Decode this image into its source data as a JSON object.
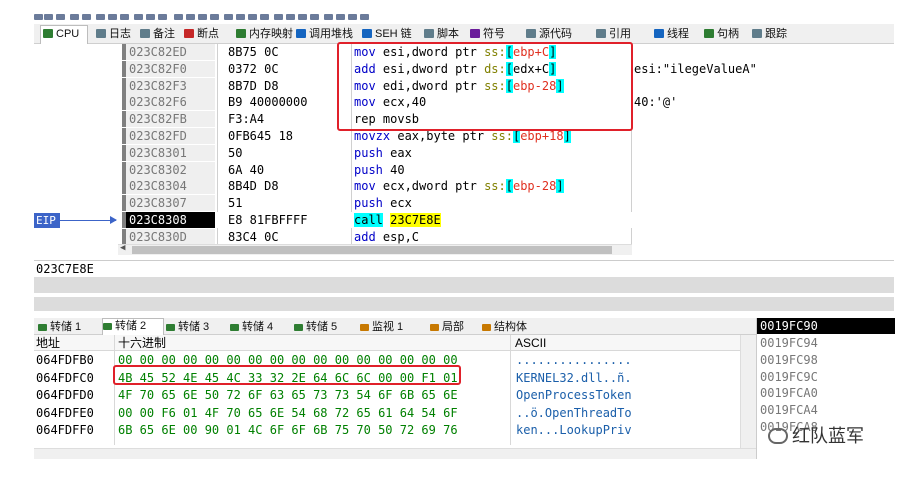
{
  "tabs": [
    {
      "label": "CPU",
      "icon": "cpu-icon",
      "color": "#2e7d32",
      "active": true
    },
    {
      "label": "日志",
      "icon": "log-icon",
      "color": "#607d8b"
    },
    {
      "label": "备注",
      "icon": "notes-icon",
      "color": "#607d8b"
    },
    {
      "label": "断点",
      "icon": "breakpoint-icon",
      "color": "#c62828"
    },
    {
      "label": "内存映射",
      "icon": "memory-map-icon",
      "color": "#2e7d32"
    },
    {
      "label": "调用堆栈",
      "icon": "call-stack-icon",
      "color": "#1565c0"
    },
    {
      "label": "SEH 链",
      "icon": "seh-chain-icon",
      "color": "#1565c0"
    },
    {
      "label": "脚本",
      "icon": "script-icon",
      "color": "#607d8b"
    },
    {
      "label": "符号",
      "icon": "symbols-icon",
      "color": "#6a1b9a"
    },
    {
      "label": "源代码",
      "icon": "source-icon",
      "color": "#607d8b"
    },
    {
      "label": "引用",
      "icon": "references-icon",
      "color": "#607d8b"
    },
    {
      "label": "线程",
      "icon": "threads-icon",
      "color": "#1565c0"
    },
    {
      "label": "句柄",
      "icon": "handles-icon",
      "color": "#2e7d32"
    },
    {
      "label": "跟踪",
      "icon": "trace-icon",
      "color": "#607d8b"
    }
  ],
  "disasm": [
    {
      "addr": "023C82ED",
      "bytes": "8B75 0C",
      "ins": [
        [
          "kw",
          "mov "
        ],
        [
          "reg",
          "esi,dword ptr "
        ],
        [
          "seg",
          "ss:"
        ],
        [
          "br",
          "["
        ],
        [
          "red",
          "ebp+C"
        ],
        [
          "br",
          "]"
        ]
      ],
      "cmt": ""
    },
    {
      "addr": "023C82F0",
      "bytes": "0372 0C",
      "ins": [
        [
          "kw",
          "add "
        ],
        [
          "reg",
          "esi,dword ptr "
        ],
        [
          "seg",
          "ds:"
        ],
        [
          "br",
          "["
        ],
        [
          "reg",
          "edx+C"
        ],
        [
          "br",
          "]"
        ]
      ],
      "cmt": "esi:\"ilegeValueA\""
    },
    {
      "addr": "023C82F3",
      "bytes": "8B7D D8",
      "ins": [
        [
          "kw",
          "mov "
        ],
        [
          "reg",
          "edi,dword ptr "
        ],
        [
          "seg",
          "ss:"
        ],
        [
          "br",
          "["
        ],
        [
          "red",
          "ebp-28"
        ],
        [
          "br",
          "]"
        ]
      ],
      "cmt": ""
    },
    {
      "addr": "023C82F6",
      "bytes": "B9 40000000",
      "ins": [
        [
          "kw",
          "mov "
        ],
        [
          "reg",
          "ecx,40"
        ]
      ],
      "cmt": "40:'@'"
    },
    {
      "addr": "023C82FB",
      "bytes": "F3:A4",
      "ins": [
        [
          "reg",
          "rep movsb"
        ]
      ],
      "cmt": ""
    },
    {
      "addr": "023C82FD",
      "bytes": "0FB645 18",
      "ins": [
        [
          "kw",
          "movzx "
        ],
        [
          "reg",
          "eax,byte ptr "
        ],
        [
          "seg",
          "ss:"
        ],
        [
          "br",
          "["
        ],
        [
          "red",
          "ebp+18"
        ],
        [
          "br",
          "]"
        ]
      ],
      "cmt": ""
    },
    {
      "addr": "023C8301",
      "bytes": "50",
      "ins": [
        [
          "kw",
          "push "
        ],
        [
          "reg",
          "eax"
        ]
      ],
      "cmt": ""
    },
    {
      "addr": "023C8302",
      "bytes": "6A 40",
      "ins": [
        [
          "kw",
          "push "
        ],
        [
          "reg",
          "40"
        ]
      ],
      "cmt": ""
    },
    {
      "addr": "023C8304",
      "bytes": "8B4D D8",
      "ins": [
        [
          "kw",
          "mov "
        ],
        [
          "reg",
          "ecx,dword ptr "
        ],
        [
          "seg",
          "ss:"
        ],
        [
          "br",
          "["
        ],
        [
          "red",
          "ebp-28"
        ],
        [
          "br",
          "]"
        ]
      ],
      "cmt": ""
    },
    {
      "addr": "023C8307",
      "bytes": "51",
      "ins": [
        [
          "kw",
          "push "
        ],
        [
          "reg",
          "ecx"
        ]
      ],
      "cmt": ""
    },
    {
      "addr": "023C8308",
      "bytes": "E8 81FBFFFF",
      "ins": [
        [
          "call",
          "call"
        ],
        [
          "reg",
          " "
        ],
        [
          "target",
          "23C7E8E"
        ]
      ],
      "cmt": "",
      "eip": true
    },
    {
      "addr": "023C830D",
      "bytes": "83C4 0C",
      "ins": [
        [
          "kw",
          "add "
        ],
        [
          "reg",
          "esp,C"
        ]
      ],
      "cmt": ""
    }
  ],
  "eip_label": "EIP",
  "info_text": "023C7E8E",
  "dump_tabs": [
    {
      "label": "转储 1",
      "icon": "dump-icon"
    },
    {
      "label": "转储 2",
      "icon": "dump-icon",
      "active": true
    },
    {
      "label": "转储 3",
      "icon": "dump-icon"
    },
    {
      "label": "转储 4",
      "icon": "dump-icon"
    },
    {
      "label": "转储 5",
      "icon": "dump-icon"
    },
    {
      "label": "监视 1",
      "icon": "watch-icon"
    },
    {
      "label": "局部",
      "icon": "locals-icon"
    },
    {
      "label": "结构体",
      "icon": "struct-icon"
    }
  ],
  "dump_headers": {
    "addr": "地址",
    "hex": "十六进制",
    "ascii": "ASCII"
  },
  "dump_rows": [
    {
      "addr": "064FDFB0",
      "hex": "00 00 00 00 00 00 00 00 00 00 00 00 00 00 00 00",
      "ascii": "................"
    },
    {
      "addr": "064FDFC0",
      "hex": "4B 45 52 4E 45 4C 33 32 2E 64 6C 6C 00 00 F1 01",
      "ascii": "KERNEL32.dll..ñ."
    },
    {
      "addr": "064FDFD0",
      "hex": "4F 70 65 6E 50 72 6F 63 65 73 73 54 6F 6B 65 6E",
      "ascii": "OpenProcessToken"
    },
    {
      "addr": "064FDFE0",
      "hex": "00 00 F6 01 4F 70 65 6E 54 68 72 65 61 64 54 6F",
      "ascii": "..ö.OpenThreadTo"
    },
    {
      "addr": "064FDFF0",
      "hex": "6B 65 6E 00 90 01 4C 6F 6F 6B 75 70 50 72 69 76",
      "ascii": "ken...LookupPriv"
    }
  ],
  "stack": {
    "top": "0019FC90",
    "rows": [
      "0019FC94",
      "0019FC98",
      "0019FC9C",
      "0019FCA0",
      "0019FCA4",
      "0019FCA8"
    ]
  },
  "watermark": "红队蓝军",
  "colors": {
    "accent": "#3c64c8",
    "highlight_box": "#e0202a",
    "ascii": "#1b5faa",
    "hex": "#008000"
  }
}
